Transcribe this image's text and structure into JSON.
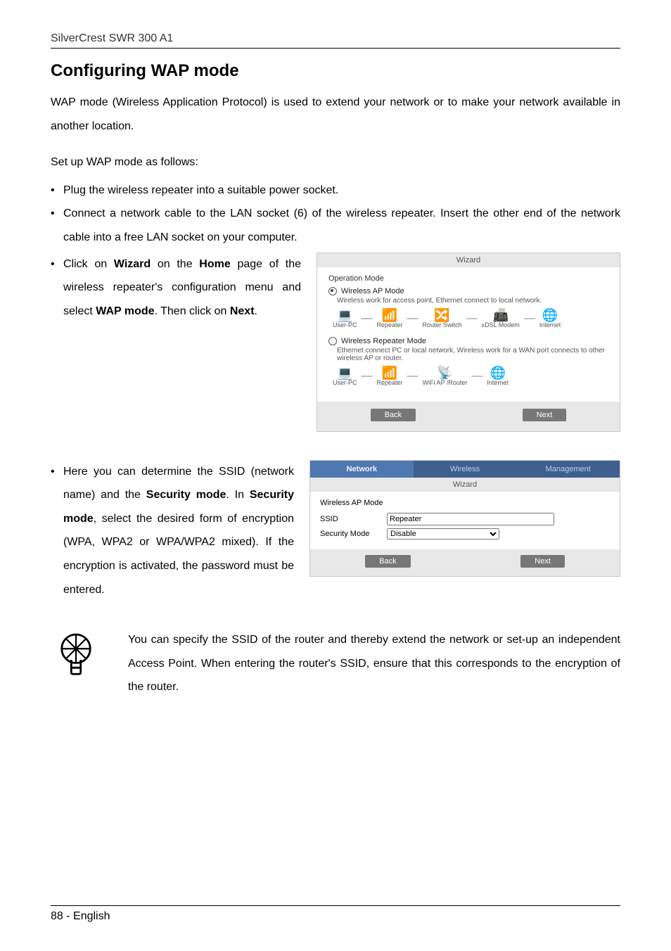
{
  "header": {
    "product": "SilverCrest SWR 300 A1"
  },
  "section": {
    "title": "Configuring WAP mode",
    "intro": "WAP mode (Wireless Application Protocol) is used to extend your network or to make your network available in another location.",
    "setup_line": "Set up WAP mode as follows:"
  },
  "bullets": {
    "b1": "Plug the wireless repeater into a suitable power socket.",
    "b2": "Connect a network cable to the LAN socket (6) of the wireless repeater. Insert the other end of the network cable into a free LAN socket on your computer.",
    "b3_pre": "Click on ",
    "b3_wizard": "Wizard",
    "b3_mid1": " on the ",
    "b3_home": "Home",
    "b3_mid2": " page of the wireless repeater's configuration menu and select ",
    "b3_wap": "WAP mode",
    "b3_mid3": ". Then click on ",
    "b3_next": "Next",
    "b3_end": ".",
    "b4_pre": "Here you can determine the SSID (network name) and the ",
    "b4_secmode": "Security mode",
    "b4_mid1": ". In ",
    "b4_secmode2": "Security mode",
    "b4_mid2": ", select the desired form of encryption (WPA, WPA2 or WPA/WPA2 mixed). If the encryption is activated, the password must be entered."
  },
  "wizard_panel": {
    "title": "Wizard",
    "operation_mode": "Operation Mode",
    "ap_mode_title": "Wireless AP Mode",
    "ap_mode_desc": "Wireless work for access point, Ethernet connect to local network.",
    "rep_mode_title": "Wireless Repeater Mode",
    "rep_mode_desc": "Ethernet connect PC or local network, Wireless work for a WAN port connects to other wireless AP or router.",
    "labels": {
      "userpc": "User-PC",
      "repeater": "Repeater",
      "router_switch": "Router Switch",
      "xdsl": "xDSL Modem",
      "internet": "Internet",
      "wifi_ap": "WiFi AP /Router"
    },
    "back": "Back",
    "next": "Next"
  },
  "ap_panel": {
    "tabs": {
      "network": "Network",
      "wireless": "Wireless",
      "management": "Management"
    },
    "sub": "Wizard",
    "section": "Wireless AP Mode",
    "rows": {
      "ssid_label": "SSID",
      "ssid_value": "Repeater",
      "sec_label": "Security Mode",
      "sec_value": "Disable"
    },
    "back": "Back",
    "next": "Next"
  },
  "note": {
    "text": "You can specify the SSID of the router and thereby extend the network or set-up an independent Access Point. When entering the router's SSID, ensure that this corresponds to the encryption of the router."
  },
  "footer": {
    "page": "88 - English"
  }
}
